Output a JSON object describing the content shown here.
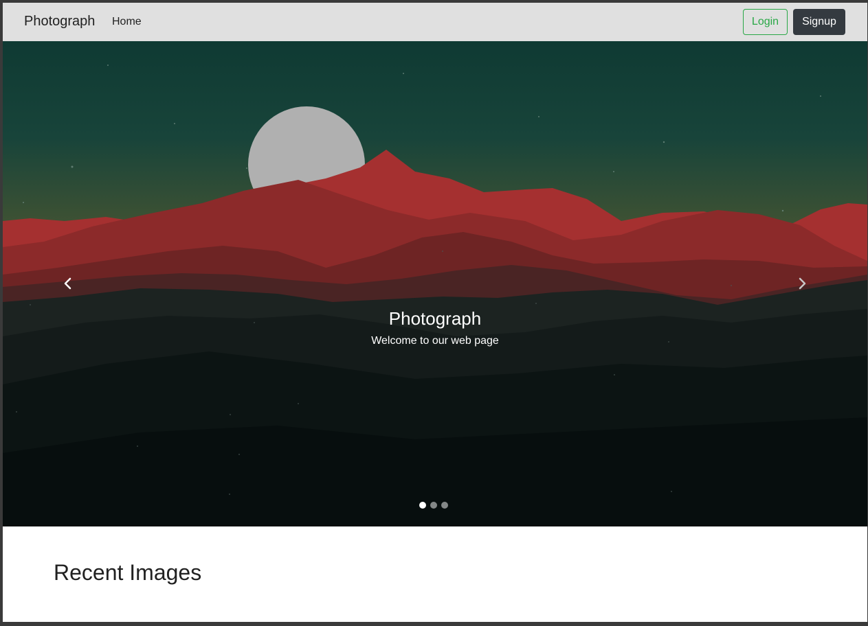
{
  "navbar": {
    "brand": "Photograph",
    "links": [
      {
        "label": "Home"
      }
    ],
    "login_label": "Login",
    "signup_label": "Signup"
  },
  "carousel": {
    "caption_title": "Photograph",
    "caption_text": "Welcome to our web page",
    "slide_count": 3,
    "active_slide": 1,
    "prev_icon": "chevron-left-icon",
    "next_icon": "chevron-right-icon"
  },
  "section": {
    "title": "Recent Images"
  },
  "colors": {
    "navbar_bg": "#e0e0e0",
    "login_accent": "#28a745",
    "signup_bg": "#343a40"
  }
}
